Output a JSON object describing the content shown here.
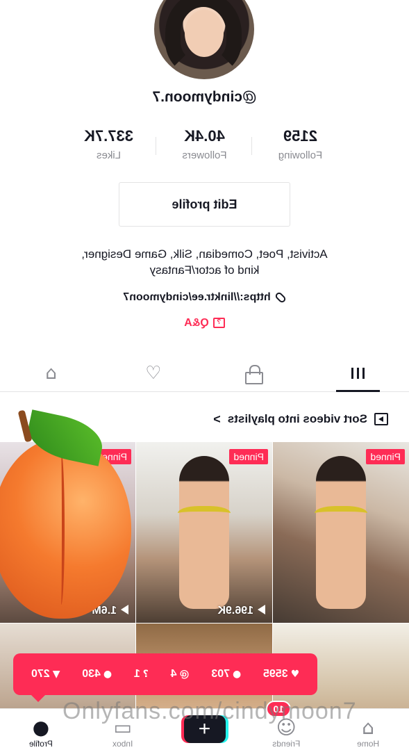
{
  "profile": {
    "username": "@cindymoon.7",
    "stats": [
      {
        "value": "2159",
        "label": "Following"
      },
      {
        "value": "40.4K",
        "label": "Followers"
      },
      {
        "value": "337.7K",
        "label": "Likes"
      }
    ],
    "edit_button": "Edit profile",
    "bio_line1": "Activist, Poet, Comedian, Silk, Game Designer,",
    "bio_line2": "kind of actor/Fantasy",
    "link": "https://linktr.ee/cindymoon7",
    "qa_label": "Q&A"
  },
  "tabs": [
    {
      "icon": "grid-icon",
      "active": true
    },
    {
      "icon": "lock-icon"
    },
    {
      "icon": "liked-heart-icon"
    },
    {
      "icon": "tagged-icon"
    }
  ],
  "sort_row": {
    "label": "Sort videos into playlists",
    "chevron": ">"
  },
  "videos": [
    {
      "pinned": "Pinned",
      "views": ""
    },
    {
      "pinned": "Pinned",
      "views": "196.9K"
    },
    {
      "pinned": "Pinned",
      "views": "1.6M"
    },
    {
      "pinned": "",
      "views": ""
    },
    {
      "pinned": "",
      "views": ""
    },
    {
      "pinned": "",
      "views": ""
    }
  ],
  "overlay_stats": [
    {
      "icon": "heart-icon",
      "value": "3595"
    },
    {
      "icon": "comment-icon",
      "value": "703"
    },
    {
      "icon": "mention-icon",
      "value": "4"
    },
    {
      "icon": "question-icon",
      "value": "1"
    },
    {
      "icon": "person-icon",
      "value": "430"
    },
    {
      "icon": "filter-icon",
      "value": "270"
    }
  ],
  "watermark": "Onlyfans.com/cindymoon7",
  "bottom_nav": {
    "home": "Home",
    "friends": "Friends",
    "friends_badge": "10",
    "inbox": "Inbox",
    "profile": "Profile"
  },
  "colors": {
    "accent": "#fe2c55",
    "text": "#161823",
    "muted": "#8a8b91"
  }
}
